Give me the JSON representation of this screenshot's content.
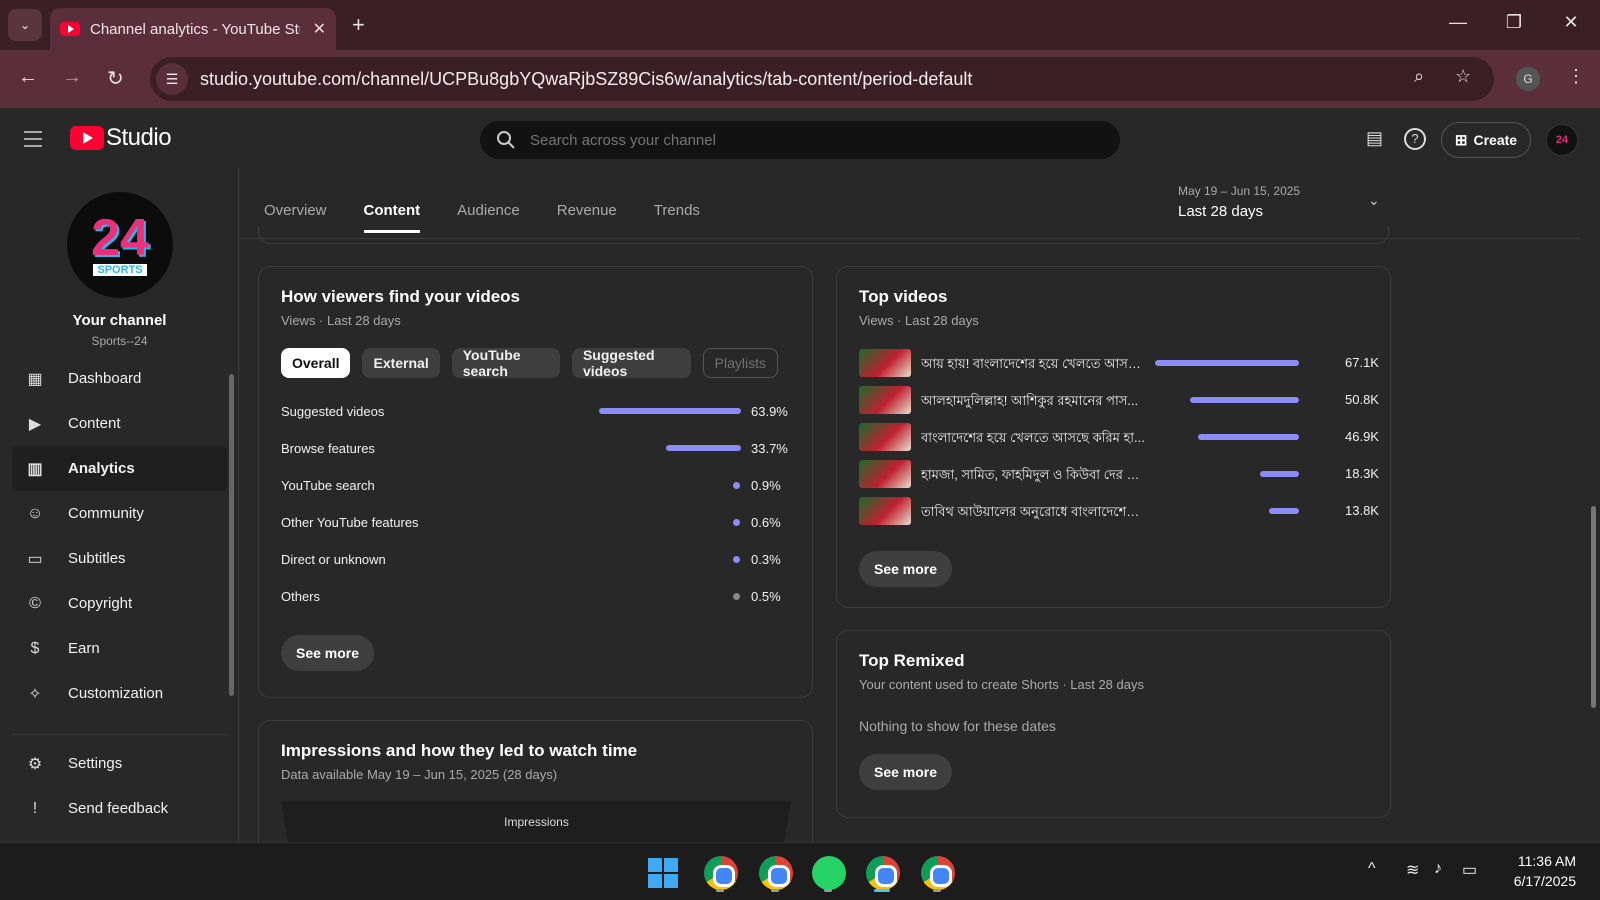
{
  "browser": {
    "tab_title": "Channel analytics - YouTube Studio",
    "url": "studio.youtube.com/channel/UCPBu8gbYQwaRjbSZ89Cis6w/analytics/tab-content/period-default",
    "profile_initial": "G"
  },
  "header": {
    "logo_text": "Studio",
    "search_placeholder": "Search across your channel",
    "create_label": "Create"
  },
  "sidebar": {
    "avatar_number": "24",
    "avatar_word": "SPORTS",
    "channel_title": "Your channel",
    "channel_name": "Sports--24",
    "items": [
      {
        "label": "Dashboard",
        "icon": "dashboard-icon"
      },
      {
        "label": "Content",
        "icon": "content-icon"
      },
      {
        "label": "Analytics",
        "icon": "analytics-icon"
      },
      {
        "label": "Community",
        "icon": "community-icon"
      },
      {
        "label": "Subtitles",
        "icon": "subtitles-icon"
      },
      {
        "label": "Copyright",
        "icon": "copyright-icon"
      },
      {
        "label": "Earn",
        "icon": "dollar-icon"
      },
      {
        "label": "Customization",
        "icon": "wand-icon"
      }
    ],
    "bottom": [
      {
        "label": "Settings",
        "icon": "gear-icon"
      },
      {
        "label": "Send feedback",
        "icon": "feedback-icon"
      }
    ]
  },
  "tabs": [
    "Overview",
    "Content",
    "Audience",
    "Revenue",
    "Trends"
  ],
  "active_tab": "Content",
  "date_range": {
    "dates": "May 19 – Jun 15, 2025",
    "label": "Last 28 days"
  },
  "traffic_card": {
    "title": "How viewers find your videos",
    "subtitle": "Views · Last 28 days",
    "chips": [
      "Overall",
      "External",
      "YouTube search",
      "Suggested videos",
      "Playlists"
    ],
    "rows": [
      {
        "label": "Suggested videos",
        "pct": "63.9%",
        "value": 63.9
      },
      {
        "label": "Browse features",
        "pct": "33.7%",
        "value": 33.7
      },
      {
        "label": "YouTube search",
        "pct": "0.9%",
        "value": 0.9
      },
      {
        "label": "Other YouTube features",
        "pct": "0.6%",
        "value": 0.6
      },
      {
        "label": "Direct or unknown",
        "pct": "0.3%",
        "value": 0.3
      },
      {
        "label": "Others",
        "pct": "0.5%",
        "value": 0.5
      }
    ],
    "see_more": "See more"
  },
  "top_videos": {
    "title": "Top videos",
    "subtitle": "Views · Last 28 days",
    "videos": [
      {
        "title": "আয় হায়! বাংলাদেশের হয়ে খেলতে আসছে ...",
        "views": "67.1K",
        "value": 67.1
      },
      {
        "title": "আলহামদুলিল্লাহ! আশিকুর রহমানের পাস...",
        "views": "50.8K",
        "value": 50.8
      },
      {
        "title": "বাংলাদেশের হয়ে খেলতে আসছে করিম হা...",
        "views": "46.9K",
        "value": 46.9
      },
      {
        "title": "হামজা, সামিত, ফাহমিদুল ও কিউবা দের দে...",
        "views": "18.3K",
        "value": 18.3
      },
      {
        "title": "তাবিথ আউয়ালের অনুরোধে বাংলাদেশের হ...",
        "views": "13.8K",
        "value": 13.8
      }
    ],
    "see_more": "See more"
  },
  "top_remixed": {
    "title": "Top Remixed",
    "subtitle": "Your content used to create Shorts · Last 28 days",
    "empty": "Nothing to show for these dates",
    "see_more": "See more"
  },
  "impressions": {
    "title": "Impressions and how they led to watch time",
    "subtitle": "Data available May 19 – Jun 15, 2025 (28 days)",
    "funnel_label": "Impressions"
  },
  "taskbar": {
    "time": "11:36 AM",
    "date": "6/17/2025"
  }
}
